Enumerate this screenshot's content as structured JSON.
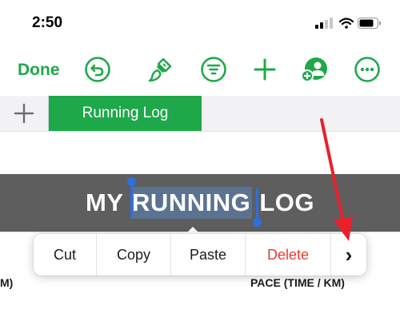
{
  "status_bar": {
    "time": "2:50"
  },
  "toolbar": {
    "done_label": "Done",
    "icons": [
      "undo-icon",
      "paintbrush-icon",
      "filter-icon",
      "plus-icon",
      "collaborate-icon",
      "more-icon"
    ],
    "accent_color": "#1fa84a"
  },
  "sheets": {
    "add_label": "+",
    "active_tab": "Running Log"
  },
  "cell": {
    "title_before": "MY ",
    "title_selected": "RUNNING",
    "title_after": " LOG"
  },
  "columns": {
    "left_partial": "M)",
    "pace": "PACE (TIME / KM)"
  },
  "context_menu": {
    "cut": "Cut",
    "copy": "Copy",
    "paste": "Paste",
    "delete": "Delete",
    "more": "›"
  },
  "colors": {
    "title_band": "#5e5e5e",
    "selection_highlight": "#5b7290",
    "handle": "#2f6fe0",
    "delete_text": "#ec3b33",
    "annotation_arrow": "#e8202a"
  }
}
